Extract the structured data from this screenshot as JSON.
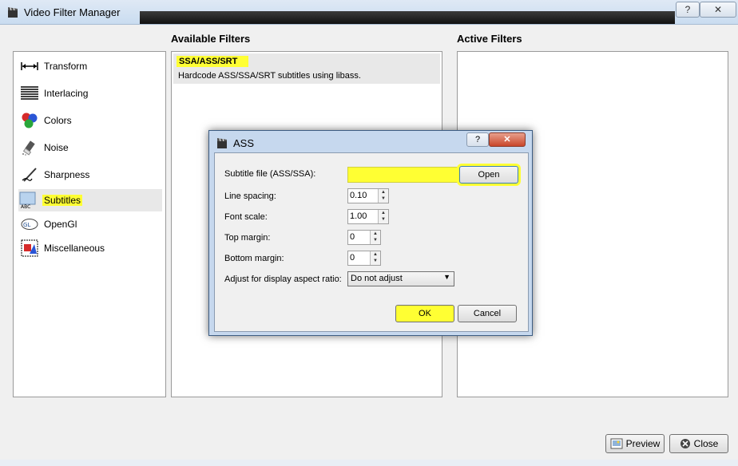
{
  "window": {
    "title": "Video Filter Manager",
    "help_label": "?",
    "close_label": "✕"
  },
  "categories": [
    {
      "label": "Transform",
      "icon": "transform-icon"
    },
    {
      "label": "Interlacing",
      "icon": "interlacing-icon"
    },
    {
      "label": "Colors",
      "icon": "colors-icon"
    },
    {
      "label": "Noise",
      "icon": "noise-icon"
    },
    {
      "label": "Sharpness",
      "icon": "sharpness-icon"
    },
    {
      "label": "Subtitles",
      "icon": "subtitles-icon"
    },
    {
      "label": "OpenGl",
      "icon": "opengl-icon"
    },
    {
      "label": "Miscellaneous",
      "icon": "miscellaneous-icon"
    }
  ],
  "available": {
    "heading": "Available Filters",
    "items": [
      {
        "name": "SSA/ASS/SRT",
        "desc": "Hardcode ASS/SSA/SRT subtitles using libass."
      }
    ]
  },
  "active": {
    "heading": "Active Filters"
  },
  "buttons": {
    "preview": "Preview",
    "close": "Close"
  },
  "dialog": {
    "title": "ASS",
    "help_label": "?",
    "close_label": "✕",
    "subtitle_file_label": "Subtitle file (ASS/SSA):",
    "subtitle_file_value": "",
    "open_label": "Open",
    "line_spacing_label": "Line spacing:",
    "line_spacing_value": "0.10",
    "font_scale_label": "Font scale:",
    "font_scale_value": "1.00",
    "top_margin_label": "Top margin:",
    "top_margin_value": "0",
    "bottom_margin_label": "Bottom margin:",
    "bottom_margin_value": "0",
    "aspect_label": "Adjust for display aspect ratio:",
    "aspect_value": "Do not adjust",
    "ok_label": "OK",
    "cancel_label": "Cancel"
  },
  "colors": {
    "highlight": "#ffff33",
    "title_bar": "#c9dcf0",
    "selected_row": "#e8e8e8"
  }
}
